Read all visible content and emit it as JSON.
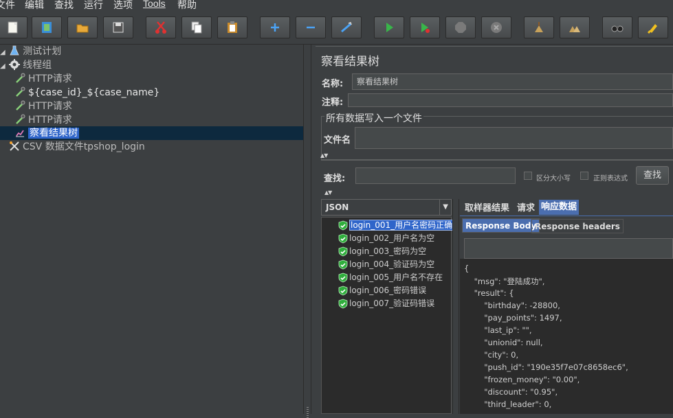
{
  "menu": [
    "文件",
    "编辑",
    "查找",
    "运行",
    "选项",
    "Tools",
    "帮助"
  ],
  "toolbar": {
    "buttons": [
      "new-icon",
      "templates-icon",
      "open-icon",
      "save-icon",
      "cut-icon",
      "copy-icon",
      "paste-icon",
      "expand-icon",
      "collapse-icon",
      "toggle-icon",
      "start-icon",
      "start-no-pause-icon",
      "stop-icon",
      "shutdown-icon",
      "clear-icon",
      "clear-all-icon",
      "search-icon",
      "reset-search-icon"
    ]
  },
  "tree": {
    "items": [
      {
        "label": "测试计划",
        "icon": "flask-icon"
      },
      {
        "label": "线程组",
        "icon": "gear-icon"
      },
      {
        "label": "HTTP请求",
        "icon": "pipette-icon"
      },
      {
        "label": "${case_id}_${case_name}",
        "icon": "pipette-icon"
      },
      {
        "label": "HTTP请求",
        "icon": "pipette-icon"
      },
      {
        "label": "HTTP请求",
        "icon": "pipette-icon"
      },
      {
        "label": "察看结果树",
        "icon": "chart-icon"
      },
      {
        "label": "CSV 数据文件tpshop_login",
        "icon": "tools-icon"
      }
    ]
  },
  "panel": {
    "title": "察看结果树",
    "name_label": "名称:",
    "name_value": "察看结果树",
    "comment_label": "注释:",
    "comment_value": "",
    "group_title": "所有数据写入一个文件",
    "filename_label": "文件名",
    "filename_value": "",
    "search_label": "查找:",
    "search_value": "",
    "case_sensitive": "区分大小写",
    "regex": "正则表达式",
    "search_button": "查找"
  },
  "renderer": {
    "selected": "JSON"
  },
  "results": [
    "login_001_用户名密码正确",
    "login_002_用户名为空",
    "login_003_密码为空",
    "login_004_验证码为空",
    "login_005_用户名不存在",
    "login_006_密码错误",
    "login_007_验证码错误"
  ],
  "tabs": [
    "取样器结果",
    "请求",
    "响应数据"
  ],
  "subtabs": [
    "Response Body",
    "Response headers"
  ],
  "response_lines": [
    "{",
    "    \"msg\": \"登陆成功\",",
    "    \"result\": {",
    "        \"birthday\": -28800,",
    "        \"pay_points\": 1497,",
    "        \"last_ip\": \"\",",
    "        \"unionid\": null,",
    "        \"city\": 0,",
    "        \"push_id\": \"190e35f7e07c8658ec6\",",
    "        \"frozen_money\": \"0.00\",",
    "        \"discount\": \"0.95\",",
    "        \"third_leader\": 0,"
  ]
}
